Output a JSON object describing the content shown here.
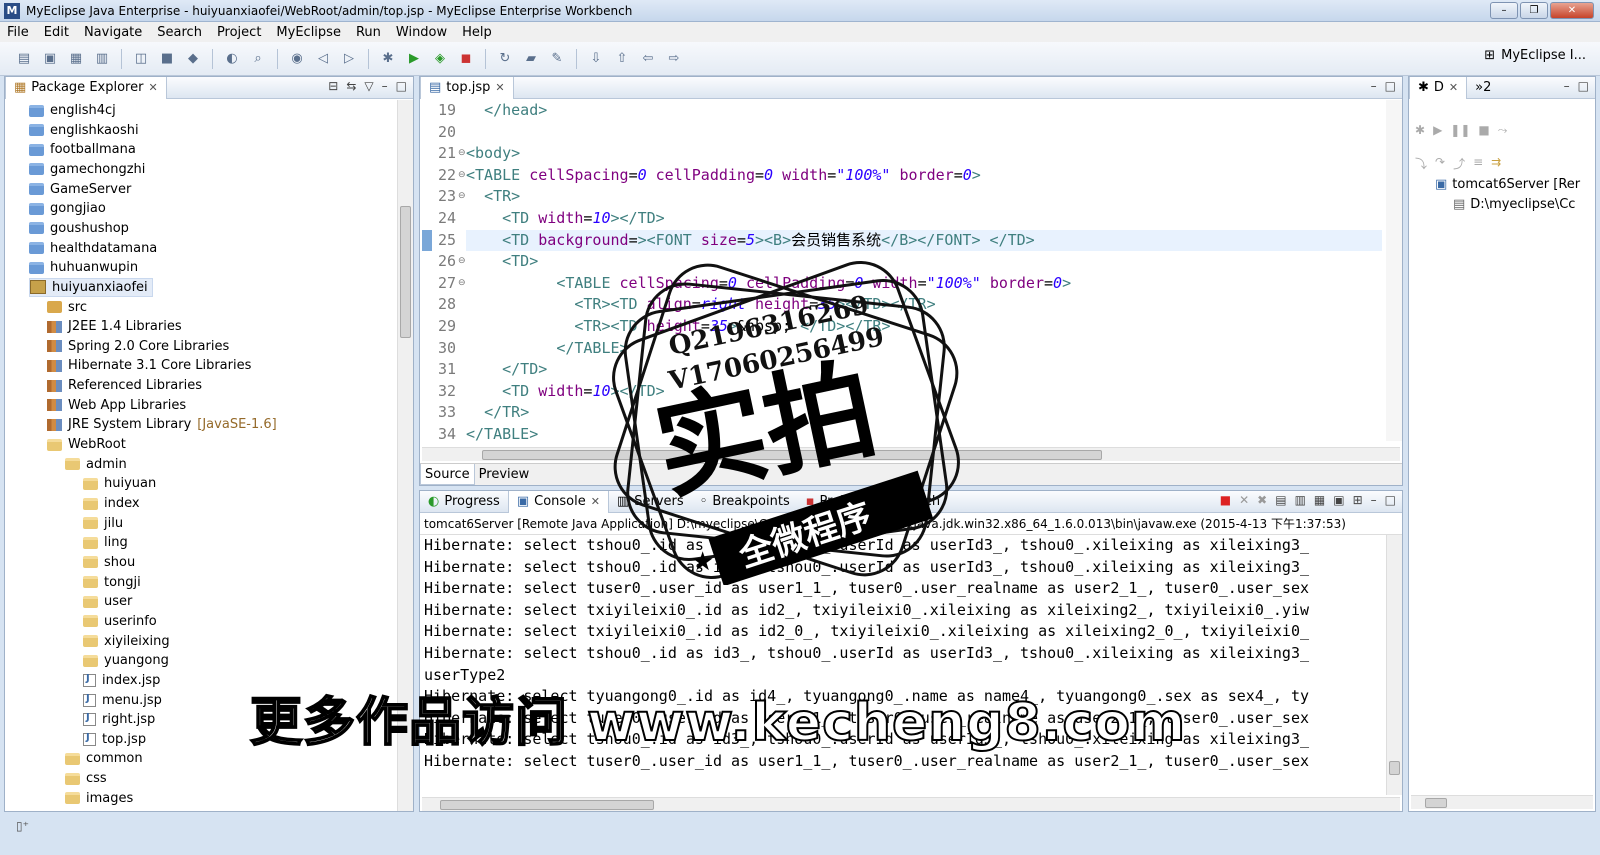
{
  "window": {
    "title": "MyEclipse Java Enterprise - huiyuanxiaofei/WebRoot/admin/top.jsp - MyEclipse Enterprise Workbench",
    "btn_min": "–",
    "btn_max": "❐",
    "btn_close": "✕"
  },
  "menu": [
    "File",
    "Edit",
    "Navigate",
    "Search",
    "Project",
    "MyEclipse",
    "Run",
    "Window",
    "Help"
  ],
  "perspective": {
    "label": "MyEclipse I..."
  },
  "package_explorer": {
    "title": "Package Explorer",
    "items": [
      {
        "label": "english4cj",
        "icon": "folder",
        "indent": 0
      },
      {
        "label": "englishkaoshi",
        "icon": "folder",
        "indent": 0
      },
      {
        "label": "footballmana",
        "icon": "folder",
        "indent": 0
      },
      {
        "label": "gamechongzhi",
        "icon": "folder",
        "indent": 0
      },
      {
        "label": "GameServer",
        "icon": "folder",
        "indent": 0
      },
      {
        "label": "gongjiao",
        "icon": "folder",
        "indent": 0
      },
      {
        "label": "goushushop",
        "icon": "folder",
        "indent": 0
      },
      {
        "label": "healthdatamana",
        "icon": "folder",
        "indent": 0
      },
      {
        "label": "huhuanwupin",
        "icon": "folder",
        "indent": 0
      },
      {
        "label": "huiyuanxiaofei",
        "icon": "project",
        "indent": 0,
        "selected": true
      },
      {
        "label": "src",
        "icon": "src",
        "indent": 1
      },
      {
        "label": "J2EE 1.4 Libraries",
        "icon": "library",
        "indent": 1
      },
      {
        "label": "Spring 2.0 Core Libraries",
        "icon": "library",
        "indent": 1
      },
      {
        "label": "Hibernate 3.1 Core Libraries",
        "icon": "library",
        "indent": 1
      },
      {
        "label": "Referenced Libraries",
        "icon": "library",
        "indent": 1
      },
      {
        "label": "Web App Libraries",
        "icon": "library",
        "indent": 1
      },
      {
        "label": "JRE System Library",
        "suffix": "[JavaSE-1.6]",
        "icon": "library",
        "indent": 1
      },
      {
        "label": "WebRoot",
        "icon": "folder-open",
        "indent": 1
      },
      {
        "label": "admin",
        "icon": "folder-open",
        "indent": 2
      },
      {
        "label": "huiyuan",
        "icon": "folder-open",
        "indent": 3
      },
      {
        "label": "index",
        "icon": "folder-open",
        "indent": 3
      },
      {
        "label": "jilu",
        "icon": "folder-open",
        "indent": 3
      },
      {
        "label": "ling",
        "icon": "folder-open",
        "indent": 3
      },
      {
        "label": "shou",
        "icon": "folder-open",
        "indent": 3
      },
      {
        "label": "tongji",
        "icon": "folder-open",
        "indent": 3
      },
      {
        "label": "user",
        "icon": "folder-open",
        "indent": 3
      },
      {
        "label": "userinfo",
        "icon": "folder-open",
        "indent": 3
      },
      {
        "label": "xiyileixing",
        "icon": "folder-open",
        "indent": 3
      },
      {
        "label": "yuangong",
        "icon": "folder-open",
        "indent": 3
      },
      {
        "label": "index.jsp",
        "icon": "jsp",
        "indent": 3
      },
      {
        "label": "menu.jsp",
        "icon": "jsp",
        "indent": 3
      },
      {
        "label": "right.jsp",
        "icon": "jsp",
        "indent": 3
      },
      {
        "label": "top.jsp",
        "icon": "jsp",
        "indent": 3
      },
      {
        "label": "common",
        "icon": "folder-open",
        "indent": 2
      },
      {
        "label": "css",
        "icon": "folder-open",
        "indent": 2
      },
      {
        "label": "images",
        "icon": "folder-open",
        "indent": 2
      }
    ]
  },
  "editor": {
    "tab": "top.jsp",
    "source_tab": "Source",
    "preview_tab": "Preview",
    "lines": [
      {
        "n": "19",
        "text": "  </head>"
      },
      {
        "n": "20",
        "text": ""
      },
      {
        "n": "21",
        "text": "<body>",
        "fold": true
      },
      {
        "n": "22",
        "text": "<TABLE cellSpacing=0 cellPadding=0 width=\"100%\" border=0>",
        "fold": true
      },
      {
        "n": "23",
        "text": "  <TR>",
        "fold": true
      },
      {
        "n": "24",
        "text": "    <TD width=10></TD>"
      },
      {
        "n": "25",
        "text": "    <TD background=><FONT size=5><B>会员销售系统</B></FONT> </TD>",
        "highlight": true
      },
      {
        "n": "26",
        "text": "    <TD>",
        "fold": true
      },
      {
        "n": "27",
        "text": "          <TABLE cellSpacing=0 cellPadding=0 width=\"100%\" border=0>",
        "fold": true
      },
      {
        "n": "28",
        "text": "            <TR><TD align=right height=35></TD></TR>"
      },
      {
        "n": "29",
        "text": "            <TR><TD height=35>&nbsp; </TD></TR>"
      },
      {
        "n": "30",
        "text": "          </TABLE>"
      },
      {
        "n": "31",
        "text": "    </TD>"
      },
      {
        "n": "32",
        "text": "    <TD width=10></TD>"
      },
      {
        "n": "33",
        "text": "  </TR>"
      },
      {
        "n": "34",
        "text": "</TABLE>"
      }
    ]
  },
  "bottom_panel": {
    "tabs": [
      "Progress",
      "Console",
      "Servers",
      "Breakpoints",
      "Problems",
      "Search"
    ],
    "console_header": "tomcat6Server [Remote Java Application] D:\\myeclipse\\Common\\binary\\com.sun.java.jdk.win32.x86_64_1.6.0.013\\bin\\javaw.exe (2015-4-13 下午1:37:53)",
    "lines": [
      "Hibernate: select tshou0_.id as id3_, tshou0_.userId as userId3_, tshou0_.xileixing as xileixing3_",
      "Hibernate: select tshou0_.id as id3_, tshou0_.userId as userId3_, tshou0_.xileixing as xileixing3_",
      "Hibernate: select tuser0_.user_id as user1_1_, tuser0_.user_realname as user2_1_, tuser0_.user_sex",
      "Hibernate: select txiyileixi0_.id as id2_, txiyileixi0_.xileixing as xileixing2_, txiyileixi0_.yiw",
      "Hibernate: select txiyileixi0_.id as id2_0_, txiyileixi0_.xileixing as xileixing2_0_, txiyileixi0_",
      "Hibernate: select tshou0_.id as id3_, tshou0_.userId as userId3_, tshou0_.xileixing as xileixing3_",
      "userType2",
      "Hibernate: select tyuangong0_.id as id4_, tyuangong0_.name as name4_, tyuangong0_.sex as sex4_, ty",
      "Hibernate: select tuser0_.user_id as user1_1_, tuser0_.user_realname as user2_1_, tuser0_.user_sex",
      "Hibernate: select tshou0_.id as id3_, tshou0_.userId as userId3_, tshou0_.xileixing as xileixing3_",
      "Hibernate: select tuser0_.user_id as user1_1_, tuser0_.user_realname as user2_1_, tuser0_.user_sex"
    ]
  },
  "debug_panel": {
    "tab": "D",
    "tab2": "»2",
    "server": "tomcat6Server [Rer",
    "path": "D:\\myeclipse\\Cc"
  },
  "overlay": {
    "stamp_line1": "Q2196316269",
    "stamp_line2": "V17060256499",
    "stamp_main": "实拍",
    "stamp_banner": "全微程序",
    "watermark": "更多作品访问 www.kecheng8.com"
  }
}
